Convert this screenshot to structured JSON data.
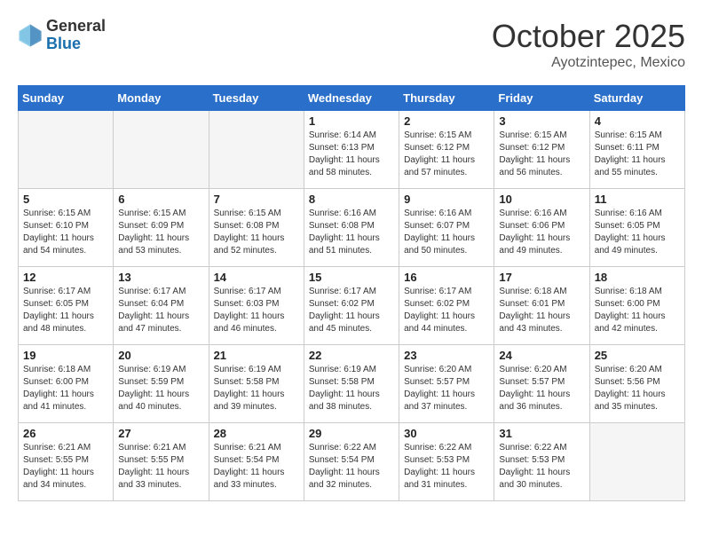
{
  "header": {
    "logo_general": "General",
    "logo_blue": "Blue",
    "month_year": "October 2025",
    "location": "Ayotzintepec, Mexico"
  },
  "weekdays": [
    "Sunday",
    "Monday",
    "Tuesday",
    "Wednesday",
    "Thursday",
    "Friday",
    "Saturday"
  ],
  "weeks": [
    [
      {
        "day": "",
        "empty": true
      },
      {
        "day": "",
        "empty": true
      },
      {
        "day": "",
        "empty": true
      },
      {
        "day": "1",
        "sunrise": "6:14 AM",
        "sunset": "6:13 PM",
        "daylight": "11 hours and 58 minutes."
      },
      {
        "day": "2",
        "sunrise": "6:15 AM",
        "sunset": "6:12 PM",
        "daylight": "11 hours and 57 minutes."
      },
      {
        "day": "3",
        "sunrise": "6:15 AM",
        "sunset": "6:12 PM",
        "daylight": "11 hours and 56 minutes."
      },
      {
        "day": "4",
        "sunrise": "6:15 AM",
        "sunset": "6:11 PM",
        "daylight": "11 hours and 55 minutes."
      }
    ],
    [
      {
        "day": "5",
        "sunrise": "6:15 AM",
        "sunset": "6:10 PM",
        "daylight": "11 hours and 54 minutes."
      },
      {
        "day": "6",
        "sunrise": "6:15 AM",
        "sunset": "6:09 PM",
        "daylight": "11 hours and 53 minutes."
      },
      {
        "day": "7",
        "sunrise": "6:15 AM",
        "sunset": "6:08 PM",
        "daylight": "11 hours and 52 minutes."
      },
      {
        "day": "8",
        "sunrise": "6:16 AM",
        "sunset": "6:08 PM",
        "daylight": "11 hours and 51 minutes."
      },
      {
        "day": "9",
        "sunrise": "6:16 AM",
        "sunset": "6:07 PM",
        "daylight": "11 hours and 50 minutes."
      },
      {
        "day": "10",
        "sunrise": "6:16 AM",
        "sunset": "6:06 PM",
        "daylight": "11 hours and 49 minutes."
      },
      {
        "day": "11",
        "sunrise": "6:16 AM",
        "sunset": "6:05 PM",
        "daylight": "11 hours and 49 minutes."
      }
    ],
    [
      {
        "day": "12",
        "sunrise": "6:17 AM",
        "sunset": "6:05 PM",
        "daylight": "11 hours and 48 minutes."
      },
      {
        "day": "13",
        "sunrise": "6:17 AM",
        "sunset": "6:04 PM",
        "daylight": "11 hours and 47 minutes."
      },
      {
        "day": "14",
        "sunrise": "6:17 AM",
        "sunset": "6:03 PM",
        "daylight": "11 hours and 46 minutes."
      },
      {
        "day": "15",
        "sunrise": "6:17 AM",
        "sunset": "6:02 PM",
        "daylight": "11 hours and 45 minutes."
      },
      {
        "day": "16",
        "sunrise": "6:17 AM",
        "sunset": "6:02 PM",
        "daylight": "11 hours and 44 minutes."
      },
      {
        "day": "17",
        "sunrise": "6:18 AM",
        "sunset": "6:01 PM",
        "daylight": "11 hours and 43 minutes."
      },
      {
        "day": "18",
        "sunrise": "6:18 AM",
        "sunset": "6:00 PM",
        "daylight": "11 hours and 42 minutes."
      }
    ],
    [
      {
        "day": "19",
        "sunrise": "6:18 AM",
        "sunset": "6:00 PM",
        "daylight": "11 hours and 41 minutes."
      },
      {
        "day": "20",
        "sunrise": "6:19 AM",
        "sunset": "5:59 PM",
        "daylight": "11 hours and 40 minutes."
      },
      {
        "day": "21",
        "sunrise": "6:19 AM",
        "sunset": "5:58 PM",
        "daylight": "11 hours and 39 minutes."
      },
      {
        "day": "22",
        "sunrise": "6:19 AM",
        "sunset": "5:58 PM",
        "daylight": "11 hours and 38 minutes."
      },
      {
        "day": "23",
        "sunrise": "6:20 AM",
        "sunset": "5:57 PM",
        "daylight": "11 hours and 37 minutes."
      },
      {
        "day": "24",
        "sunrise": "6:20 AM",
        "sunset": "5:57 PM",
        "daylight": "11 hours and 36 minutes."
      },
      {
        "day": "25",
        "sunrise": "6:20 AM",
        "sunset": "5:56 PM",
        "daylight": "11 hours and 35 minutes."
      }
    ],
    [
      {
        "day": "26",
        "sunrise": "6:21 AM",
        "sunset": "5:55 PM",
        "daylight": "11 hours and 34 minutes."
      },
      {
        "day": "27",
        "sunrise": "6:21 AM",
        "sunset": "5:55 PM",
        "daylight": "11 hours and 33 minutes."
      },
      {
        "day": "28",
        "sunrise": "6:21 AM",
        "sunset": "5:54 PM",
        "daylight": "11 hours and 33 minutes."
      },
      {
        "day": "29",
        "sunrise": "6:22 AM",
        "sunset": "5:54 PM",
        "daylight": "11 hours and 32 minutes."
      },
      {
        "day": "30",
        "sunrise": "6:22 AM",
        "sunset": "5:53 PM",
        "daylight": "11 hours and 31 minutes."
      },
      {
        "day": "31",
        "sunrise": "6:22 AM",
        "sunset": "5:53 PM",
        "daylight": "11 hours and 30 minutes."
      },
      {
        "day": "",
        "empty": true
      }
    ]
  ],
  "labels": {
    "sunrise": "Sunrise:",
    "sunset": "Sunset:",
    "daylight": "Daylight:"
  }
}
